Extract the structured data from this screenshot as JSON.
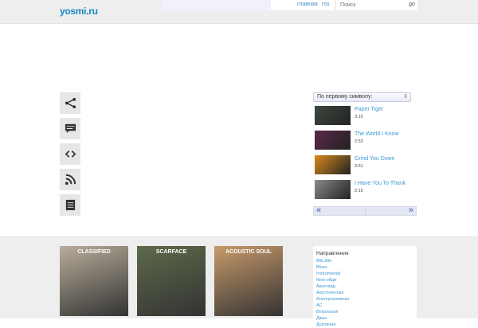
{
  "header": {
    "logo": "yosmi.ru",
    "nav": [
      "главная",
      "rss"
    ],
    "search_placeholder": "Поиск",
    "go_label": "go"
  },
  "share_icons": [
    "share-icon",
    "comment-icon",
    "embed-code-icon",
    "rss-icon",
    "document-icon"
  ],
  "playlist": {
    "sort_label": "По первому символу:",
    "tracks": [
      {
        "title": "Paper Tiger",
        "duration": "3:10",
        "color": "#3d4a3e"
      },
      {
        "title": "The World I Know",
        "duration": "2:53",
        "color": "#5a2a4a"
      },
      {
        "title": "Grind You Down",
        "duration": "3:51",
        "color": "#d98a1c"
      },
      {
        "title": "I Have You To Thank",
        "duration": "2:15",
        "color": "#8a8a8a"
      }
    ],
    "prev": "«",
    "next": "»"
  },
  "albums": [
    {
      "label": "CLASSIFIED",
      "color": "#b8ad9a"
    },
    {
      "label": "SCARFACE",
      "color": "#5e6a4a"
    },
    {
      "label": "ACOUSTIC SOUL",
      "color": "#c79a6a"
    }
  ],
  "genres": {
    "title": "Направления",
    "items": [
      "8tle,8tle",
      "Blues",
      "Instrumental",
      "New-эйдж",
      "Авангард",
      "Акустическая",
      "Альтернативная",
      "АС",
      "Вокальная",
      "Джаз",
      "Духовная"
    ]
  }
}
